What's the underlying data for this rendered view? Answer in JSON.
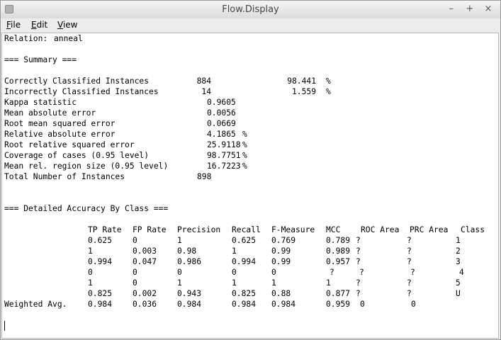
{
  "window": {
    "title": "Flow.Display"
  },
  "controls": {
    "minimize": "–",
    "maximize": "+",
    "close": "×"
  },
  "menu": {
    "file": {
      "key": "F",
      "rest": "ile"
    },
    "edit": {
      "key": "E",
      "rest": "dit"
    },
    "view": {
      "key": "V",
      "rest": "iew"
    }
  },
  "output": {
    "relation_label": "Relation:",
    "relation_value": "anneal",
    "summary_header": "=== Summary ===",
    "summary": [
      {
        "label": "Correctly Classified Instances",
        "value": "884",
        "pct": "98.441",
        "unit": "%"
      },
      {
        "label": "Incorrectly Classified Instances",
        "value": "14",
        "pct": "1.559",
        "unit": "%"
      }
    ],
    "stats": [
      {
        "label": "Kappa statistic",
        "value": "0.9605",
        "unit": ""
      },
      {
        "label": "Mean absolute error",
        "value": "0.0056",
        "unit": ""
      },
      {
        "label": "Root mean squared error",
        "value": "0.0669",
        "unit": ""
      },
      {
        "label": "Relative absolute error",
        "value": "4.1865",
        "unit": "%"
      },
      {
        "label": "Root relative squared error",
        "value": "25.9118",
        "unit": "%"
      },
      {
        "label": "Coverage of cases (0.95 level)",
        "value": "98.7751",
        "unit": "%"
      },
      {
        "label": "Mean rel. region size (0.95 level)",
        "value": "16.7223",
        "unit": "%"
      }
    ],
    "total": {
      "label": "Total Number of Instances",
      "value": "898"
    },
    "detail_header": "=== Detailed Accuracy By Class ===",
    "columns": [
      "TP Rate",
      "FP Rate",
      "Precision",
      "Recall",
      "F-Measure",
      "MCC",
      "ROC Area",
      "PRC Area",
      "Class"
    ],
    "rows": [
      {
        "label": "",
        "cells": [
          "0.625",
          "0",
          "1",
          "0.625",
          "0.769",
          "0.789",
          "?",
          "?",
          "1"
        ]
      },
      {
        "label": "",
        "cells": [
          "1",
          "0.003",
          "0.98",
          "1",
          "0.99",
          "0.989",
          "?",
          "?",
          "2"
        ]
      },
      {
        "label": "",
        "cells": [
          "0.994",
          "0.047",
          "0.986",
          "0.994",
          "0.99",
          "0.957",
          "?",
          "?",
          "3"
        ]
      },
      {
        "label": "",
        "cells": [
          "0",
          "0",
          "0",
          "0",
          "0",
          "?",
          "?",
          "?",
          "4"
        ]
      },
      {
        "label": "",
        "cells": [
          "1",
          "0",
          "1",
          "1",
          "1",
          "1",
          "?",
          "?",
          "5"
        ]
      },
      {
        "label": "",
        "cells": [
          "0.825",
          "0.002",
          "0.943",
          "0.825",
          "0.88",
          "0.877",
          "?",
          "?",
          "U"
        ]
      },
      {
        "label": "Weighted Avg.",
        "cells": [
          "0.984",
          "0.036",
          "0.984",
          "0.984",
          "0.984",
          "0.959",
          "0",
          "0",
          ""
        ]
      }
    ]
  }
}
